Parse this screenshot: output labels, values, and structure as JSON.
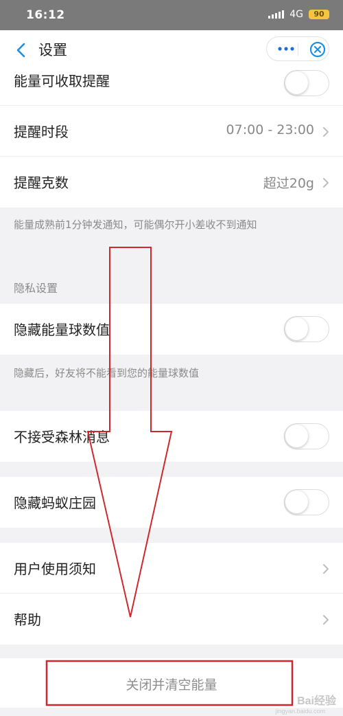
{
  "status_bar": {
    "time": "16:12",
    "network": "4G",
    "battery": "90"
  },
  "nav": {
    "title": "设置"
  },
  "rows": {
    "energy_reminder": {
      "label": "能量可收取提醒",
      "enabled": false
    },
    "reminder_period": {
      "label": "提醒时段",
      "value": "07:00 - 23:00"
    },
    "reminder_grams": {
      "label": "提醒克数",
      "value": "超过20g"
    },
    "reminder_note": "能量成熟前1分钟发通知，可能偶尔开小差收不到通知",
    "privacy_section": "隐私设置",
    "hide_energy_value": {
      "label": "隐藏能量球数值",
      "enabled": false
    },
    "hide_note": "隐藏后，好友将不能看到您的能量球数值",
    "reject_forest_messages": {
      "label": "不接受森林消息",
      "enabled": false
    },
    "hide_ant_manor": {
      "label": "隐藏蚂蚁庄园",
      "enabled": false
    },
    "user_notice": {
      "label": "用户使用须知"
    },
    "help": {
      "label": "帮助"
    },
    "close_and_clear": {
      "label": "关闭并清空能量"
    }
  },
  "watermark": {
    "text": "Bai经验",
    "sub": "jingyan.baidu.com"
  },
  "colors": {
    "accent": "#1a8fe3",
    "annotation": "#d0262e"
  }
}
